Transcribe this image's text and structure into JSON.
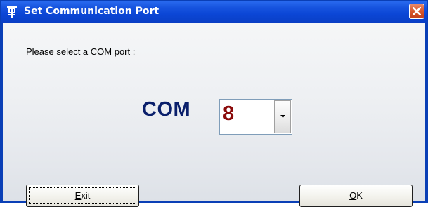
{
  "window": {
    "title": "Set Communication Port",
    "icons": {
      "app": "port-plug-icon",
      "close": "close-icon",
      "dropdown": "chevron-down-icon"
    },
    "colors": {
      "titlebar": "#0a46d6",
      "close": "#d95a2f",
      "com_label": "#0a1f6b",
      "com_value": "#8b0a0a"
    }
  },
  "dialog": {
    "prompt": "Please select a COM port :",
    "com_label": "COM",
    "com_value": "8",
    "exit": {
      "mnemonic": "E",
      "rest": "xit"
    },
    "ok": {
      "mnemonic": "O",
      "rest": "K"
    }
  }
}
